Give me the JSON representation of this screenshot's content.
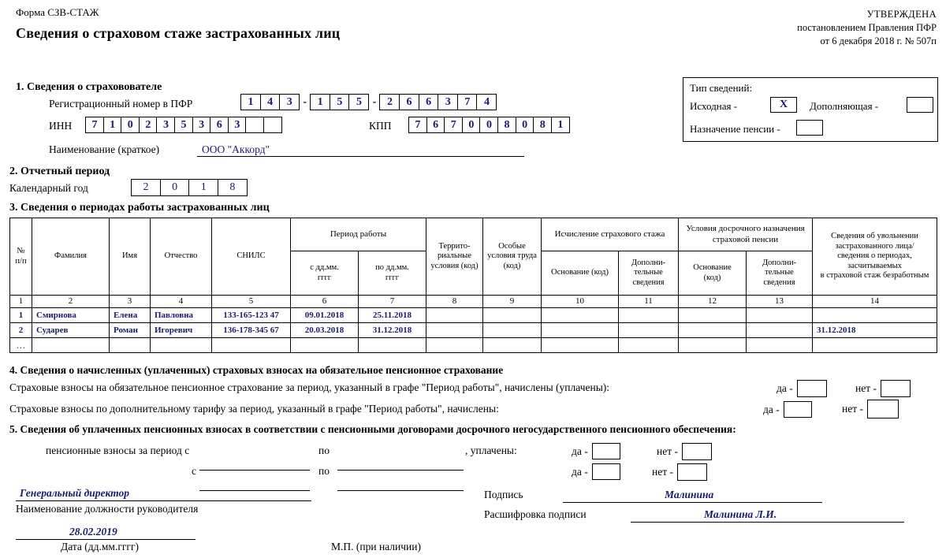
{
  "header": {
    "form_code": "Форма СЗВ-СТАЖ",
    "title": "Сведения о страховом стаже застрахованных лиц",
    "approved_line1": "УТВЕРЖДЕНА",
    "approved_line2": "постановлением Правления ПФР",
    "approved_line3": "от 6 декабря 2018 г. № 507п"
  },
  "section1": {
    "heading": "1. Сведения о страховователе",
    "reg_label": "Регистрационный номер в ПФР",
    "reg_part1": [
      "1",
      "4",
      "3"
    ],
    "reg_part2": [
      "1",
      "5",
      "5"
    ],
    "reg_part3": [
      "2",
      "6",
      "6",
      "3",
      "7",
      "4"
    ],
    "separator": "-",
    "inn_label": "ИНН",
    "inn_digits": [
      "7",
      "1",
      "0",
      "2",
      "3",
      "5",
      "3",
      "6",
      "3",
      "",
      ""
    ],
    "kpp_label": "КПП",
    "kpp_digits": [
      "7",
      "6",
      "7",
      "0",
      "0",
      "8",
      "0",
      "8",
      "1"
    ],
    "name_label": "Наименование (краткое)",
    "name_value": "ООО \"Аккорд\""
  },
  "info_type": {
    "title": "Тип сведений:",
    "initial_label": "Исходная -",
    "initial_mark": "X",
    "supplementary_label": "Дополняющая -",
    "supplementary_mark": "",
    "pension_label": "Назначение пенсии -",
    "pension_mark": ""
  },
  "section2": {
    "heading": "2. Отчетный период",
    "year_label": "Календарный год",
    "year_digits": [
      "2",
      "0",
      "1",
      "8"
    ]
  },
  "section3": {
    "heading": "3. Сведения о периодах работы застрахованных лиц",
    "headers": {
      "num": "№\nп/п",
      "num_l1": "№",
      "num_l2": "п/п",
      "surname": "Фамилия",
      "firstname": "Имя",
      "patronymic": "Отчество",
      "snils": "СНИЛС",
      "work_period": "Период работы",
      "from": "с дд.мм.\nгггг",
      "from_l1": "с дд.мм.",
      "from_l2": "гггг",
      "to_l1": "по дд.мм.",
      "to_l2": "гггг",
      "territorial": "Террито-\nриальные\nусловия (код)",
      "territorial_l1": "Террито-",
      "territorial_l2": "риальные",
      "territorial_l3": "условия (код)",
      "special_l1": "Особые",
      "special_l2": "условия труда",
      "special_l3": "(код)",
      "calc_group": "Исчисление страхового стажа",
      "calc_basis": "Основание (код)",
      "calc_extra_l1": "Дополни-",
      "calc_extra_l2": "тельные",
      "calc_extra_l3": "сведения",
      "early_group_l1": "Условия досрочного назначения",
      "early_group_l2": "страховой пенсии",
      "early_basis_l1": "Основание",
      "early_basis_l2": "(код)",
      "early_extra_l1": "Дополни-",
      "early_extra_l2": "тельные",
      "early_extra_l3": "сведения",
      "dismissal_l1": "Сведения об увольнении",
      "dismissal_l2": "застрахованного лица/",
      "dismissal_l3": "сведения о периодах,",
      "dismissal_l4": "засчитываемых",
      "dismissal_l5": "в страховой стаж безработным"
    },
    "column_numbers": [
      "1",
      "2",
      "3",
      "4",
      "5",
      "6",
      "7",
      "8",
      "9",
      "10",
      "11",
      "12",
      "13",
      "14"
    ],
    "rows": [
      {
        "num": "1",
        "surname": "Смирнова",
        "firstname": "Елена",
        "patronymic": "Павловна",
        "snils": "133-165-123 47",
        "from": "09.01.2018",
        "to": "25.11.2018",
        "c8": "",
        "c9": "",
        "c10": "",
        "c11": "",
        "c12": "",
        "c13": "",
        "c14": ""
      },
      {
        "num": "2",
        "surname": "Сударев",
        "firstname": "Роман",
        "patronymic": "Игоревич",
        "snils": "136-178-345 67",
        "from": "20.03.2018",
        "to": "31.12.2018",
        "c8": "",
        "c9": "",
        "c10": "",
        "c11": "",
        "c12": "",
        "c13": "",
        "c14": "31.12.2018"
      },
      {
        "num": "…",
        "surname": "",
        "firstname": "",
        "patronymic": "",
        "snils": "",
        "from": "",
        "to": "",
        "c8": "",
        "c9": "",
        "c10": "",
        "c11": "",
        "c12": "",
        "c13": "",
        "c14": ""
      }
    ]
  },
  "section4": {
    "heading": "4. Сведения о начисленных (уплаченных) страховых взносах на обязательное пенсионное страхование",
    "line1": "Страховые взносы на обязательное пенсионное страхование за период, указанный в графе \"Период работы\", начислены (уплачены):",
    "line2": "Страховые взносы по дополнительному тарифу за период, указанный в графе \"Период работы\", начислены:",
    "yes_label": "да -",
    "no_label": "нет -",
    "line1_yes": "",
    "line1_no": "",
    "line2_yes": "",
    "line2_no": ""
  },
  "section5": {
    "heading": "5. Сведения об уплаченных пенсионных взносах в соответствии с пенсионными договорами досрочного негосударственного пенсионного обеспечения:",
    "row1_prefix": "пенсионные взносы за период с",
    "row1_mid": "по",
    "row1_suffix": ", уплачены:",
    "row2_prefix": "с",
    "row2_mid": "по",
    "yes_label": "да -",
    "no_label": "нет -",
    "row1_from": "",
    "row1_to": "",
    "row2_from": "",
    "row2_to": "",
    "row1_yes": "",
    "row1_no": "",
    "row2_yes": "",
    "row2_no": ""
  },
  "footer": {
    "position_value": "Генеральный директор",
    "position_caption": "Наименование должности руководителя",
    "date_value": "28.02.2019",
    "date_caption": "Дата (дд.мм.гггг)",
    "stamp_caption": "М.П. (при наличии)",
    "signature_label": "Подпись",
    "signature_value": "Малинина",
    "decoding_label": "Расшифровка подписи",
    "decoding_value": "Малинина Л.И."
  }
}
